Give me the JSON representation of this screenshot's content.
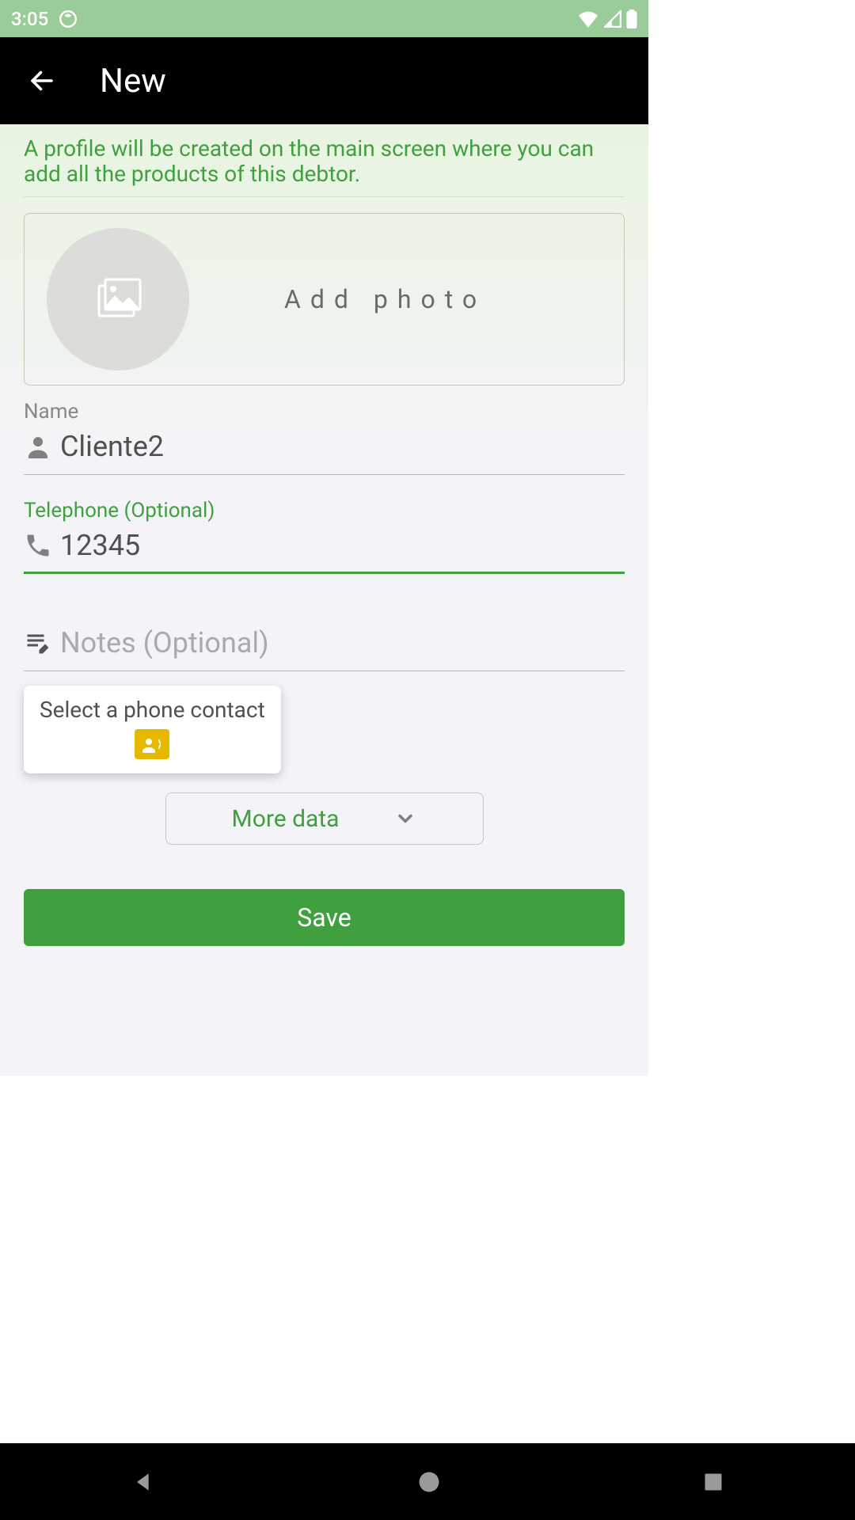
{
  "statusbar": {
    "time": "3:05"
  },
  "header": {
    "title": "New"
  },
  "hint": "A profile will be created on the main screen where you can add all the products of this debtor.",
  "photo": {
    "add_label": "Add photo"
  },
  "fields": {
    "name": {
      "label": "Name",
      "value": "Cliente2"
    },
    "telephone": {
      "label": "Telephone (Optional)",
      "value": "12345"
    },
    "notes": {
      "placeholder": "Notes (Optional)",
      "value": ""
    }
  },
  "contact_card": {
    "label": "Select a phone contact"
  },
  "more_data_label": "More data",
  "save_label": "Save"
}
